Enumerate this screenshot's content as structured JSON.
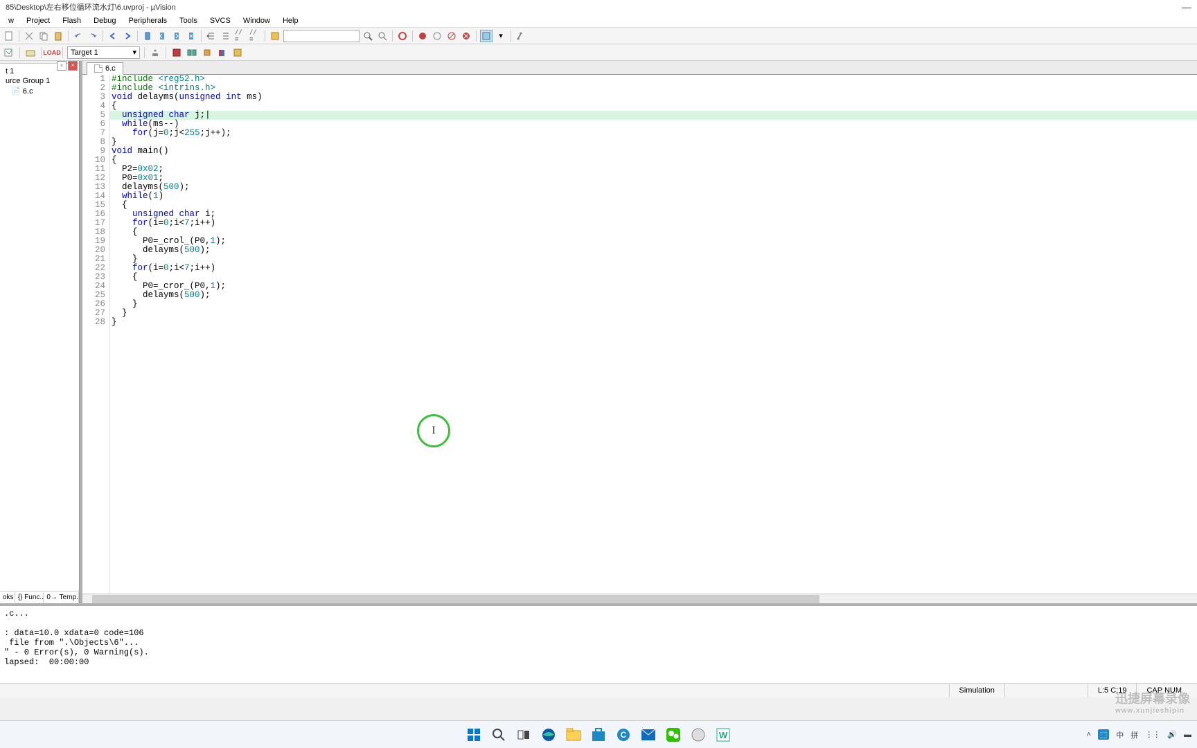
{
  "title": "85\\Desktop\\左右移位循环流水灯\\6.uvproj - µVision",
  "menus": [
    "w",
    "Project",
    "Flash",
    "Debug",
    "Peripherals",
    "Tools",
    "SVCS",
    "Window",
    "Help"
  ],
  "target_combo": "Target 1",
  "tree": {
    "item1": "t 1",
    "item2": "urce Group 1",
    "item3": "6.c"
  },
  "sidebar_tabs": [
    "oks",
    "{} Func...",
    "0→ Temp..."
  ],
  "file_tab": "6.c",
  "code": [
    {
      "n": 1,
      "html": "<span class='pp'>#include</span> <span class='str'>&lt;reg52.h&gt;</span>"
    },
    {
      "n": 2,
      "html": "<span class='pp'>#include</span> <span class='str'>&lt;intrins.h&gt;</span>"
    },
    {
      "n": 3,
      "html": "<span class='kw'>void</span> delayms(<span class='kw'>unsigned</span> <span class='kw'>int</span> ms)"
    },
    {
      "n": 4,
      "html": "{"
    },
    {
      "n": 5,
      "html": "  <span class='kw'>unsigned</span> <span class='kw'>char</span> j;|",
      "hl": true
    },
    {
      "n": 6,
      "html": "  <span class='kw'>while</span>(ms--)"
    },
    {
      "n": 7,
      "html": "    <span class='kw'>for</span>(j=<span class='num'>0</span>;j&lt;<span class='num'>255</span>;j++);"
    },
    {
      "n": 8,
      "html": "}"
    },
    {
      "n": 9,
      "html": "<span class='kw'>void</span> main()"
    },
    {
      "n": 10,
      "html": "{"
    },
    {
      "n": 11,
      "html": "  P2=<span class='num'>0x02</span>;"
    },
    {
      "n": 12,
      "html": "  P0=<span class='num'>0x01</span>;"
    },
    {
      "n": 13,
      "html": "  delayms(<span class='num'>500</span>);"
    },
    {
      "n": 14,
      "html": "  <span class='kw'>while</span>(<span class='num'>1</span>)"
    },
    {
      "n": 15,
      "html": "  {"
    },
    {
      "n": 16,
      "html": "    <span class='kw'>unsigned</span> <span class='kw'>char</span> i;"
    },
    {
      "n": 17,
      "html": "    <span class='kw'>for</span>(i=<span class='num'>0</span>;i&lt;<span class='num'>7</span>;i++)"
    },
    {
      "n": 18,
      "html": "    {"
    },
    {
      "n": 19,
      "html": "      P0=_crol_(P0,<span class='num'>1</span>);"
    },
    {
      "n": 20,
      "html": "      delayms(<span class='num'>500</span>);"
    },
    {
      "n": 21,
      "html": "    }"
    },
    {
      "n": 22,
      "html": "    <span class='kw'>for</span>(i=<span class='num'>0</span>;i&lt;<span class='num'>7</span>;i++)"
    },
    {
      "n": 23,
      "html": "    {"
    },
    {
      "n": 24,
      "html": "      P0=_cror_(P0,<span class='num'>1</span>);"
    },
    {
      "n": 25,
      "html": "      delayms(<span class='num'>500</span>);"
    },
    {
      "n": 26,
      "html": "    }"
    },
    {
      "n": 27,
      "html": "  }"
    },
    {
      "n": 28,
      "html": "}"
    }
  ],
  "cursor_char": "I",
  "output_lines": [
    ".c...",
    "",
    ": data=10.0 xdata=0 code=106",
    " file from \".\\Objects\\6\"...",
    "\" - 0 Error(s), 0 Warning(s).",
    "lapsed:  00:00:00"
  ],
  "status": {
    "mode": "Simulation",
    "pos": "L:5 C:19",
    "caps": "CAP NUM"
  },
  "tray": {
    "ime": "中",
    "input": "拼"
  },
  "watermark": {
    "main": "迅捷屏幕录像",
    "sub": "www.xunjieshipin"
  }
}
